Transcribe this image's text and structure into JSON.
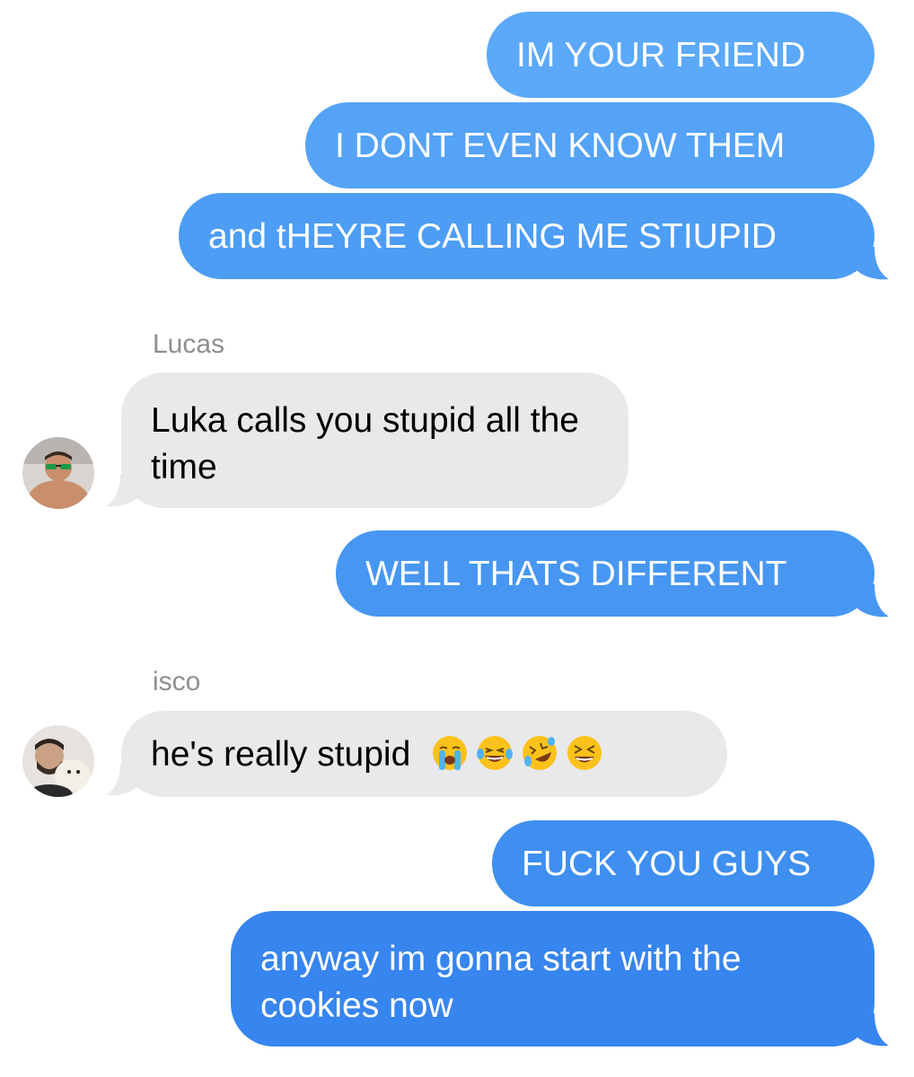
{
  "conversation": {
    "messages": [
      {
        "id": "m1",
        "direction": "outgoing",
        "text": "IM YOUR FRIEND"
      },
      {
        "id": "m2",
        "direction": "outgoing",
        "text": "I DONT EVEN KNOW THEM"
      },
      {
        "id": "m3",
        "direction": "outgoing",
        "text": "and tHEYRE CALLING ME STIUPID"
      },
      {
        "id": "m4",
        "direction": "incoming",
        "sender": "Lucas",
        "text": "Luka calls you stupid all the time"
      },
      {
        "id": "m5",
        "direction": "outgoing",
        "text": "WELL THATS DIFFERENT"
      },
      {
        "id": "m6",
        "direction": "incoming",
        "sender": "isco",
        "text": "he's really stupid",
        "emojis": [
          "loudly-crying-face-icon",
          "face-with-tears-of-joy-icon",
          "rolling-on-floor-laughing-icon",
          "grinning-squinting-face-icon"
        ]
      },
      {
        "id": "m7",
        "direction": "outgoing",
        "text": "FUCK YOU GUYS"
      },
      {
        "id": "m8",
        "direction": "outgoing",
        "text": "anyway im gonna start with the cookies now"
      }
    ]
  },
  "colors": {
    "outgoing_top": "#5aa9f8",
    "outgoing_bottom": "#2b7cf0",
    "incoming": "#e9e9eb",
    "sender_label": "#8e8e93"
  }
}
